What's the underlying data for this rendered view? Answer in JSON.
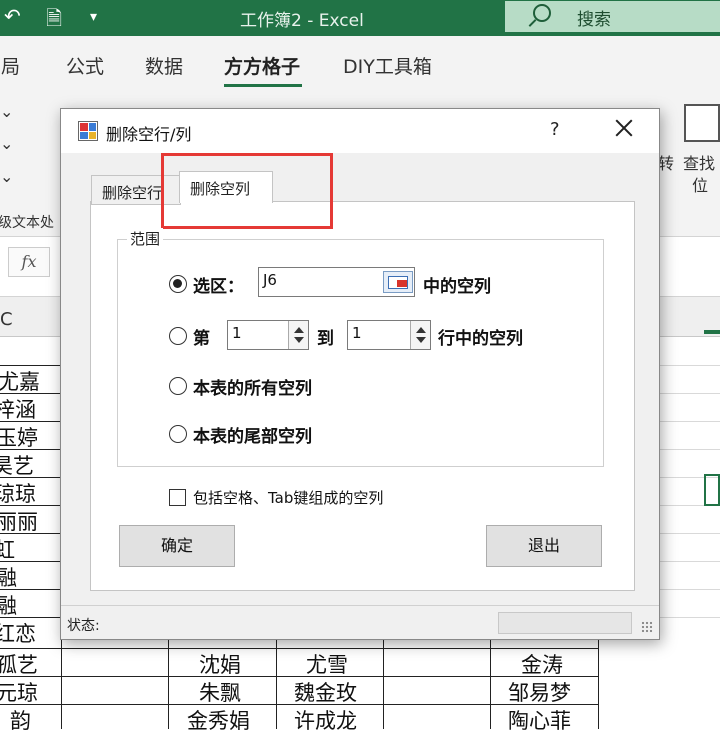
{
  "window": {
    "title": "工作簿2  -  Excel"
  },
  "search": {
    "label": "搜索"
  },
  "ribbon": {
    "tabs": [
      {
        "label": "布局"
      },
      {
        "label": "公式"
      },
      {
        "label": "数据"
      },
      {
        "label": "方方格子",
        "active": true
      },
      {
        "label": "DIY工具箱"
      }
    ],
    "fragments": {
      "group_label": "级文本处",
      "rotate_label": "转",
      "find_label": "查找",
      "position_label": "位"
    }
  },
  "formula_bar": {
    "fx": "fx"
  },
  "grid": {
    "col_header": "C",
    "left_col": [
      "尤嘉",
      "梓涵",
      "玉婷",
      "昊艺",
      "琼琼",
      "丽丽",
      "虹",
      "融",
      "融",
      "红恋",
      "孤艺",
      "元琼",
      "韵"
    ],
    "bottom_rows": [
      [
        "沈娟",
        "尤雪",
        "金涛"
      ],
      [
        "朱飘",
        "魏金玫",
        "邹易梦"
      ],
      [
        "金秀娟",
        "许成龙",
        "陶心菲"
      ]
    ]
  },
  "dialog": {
    "title": "删除空行/列",
    "help": "?",
    "tabs": {
      "delete_rows": "删除空行",
      "delete_cols": "删除空列"
    },
    "range_group": "范围",
    "options": {
      "selection_label": "选区：",
      "selection_value": "J6",
      "selection_suffix": "中的空列",
      "row_prefix": "第",
      "row_from": "1",
      "row_to_label": "到",
      "row_to": "1",
      "row_suffix": "行中的空列",
      "all_cols": "本表的所有空列",
      "tail_cols": "本表的尾部空列"
    },
    "checkbox_label": "包括空格、Tab键组成的空列",
    "ok_button": "确定",
    "exit_button": "退出",
    "status_label": "状态:"
  },
  "colors": {
    "excel_green": "#217346",
    "highlight_red": "#e53935"
  }
}
